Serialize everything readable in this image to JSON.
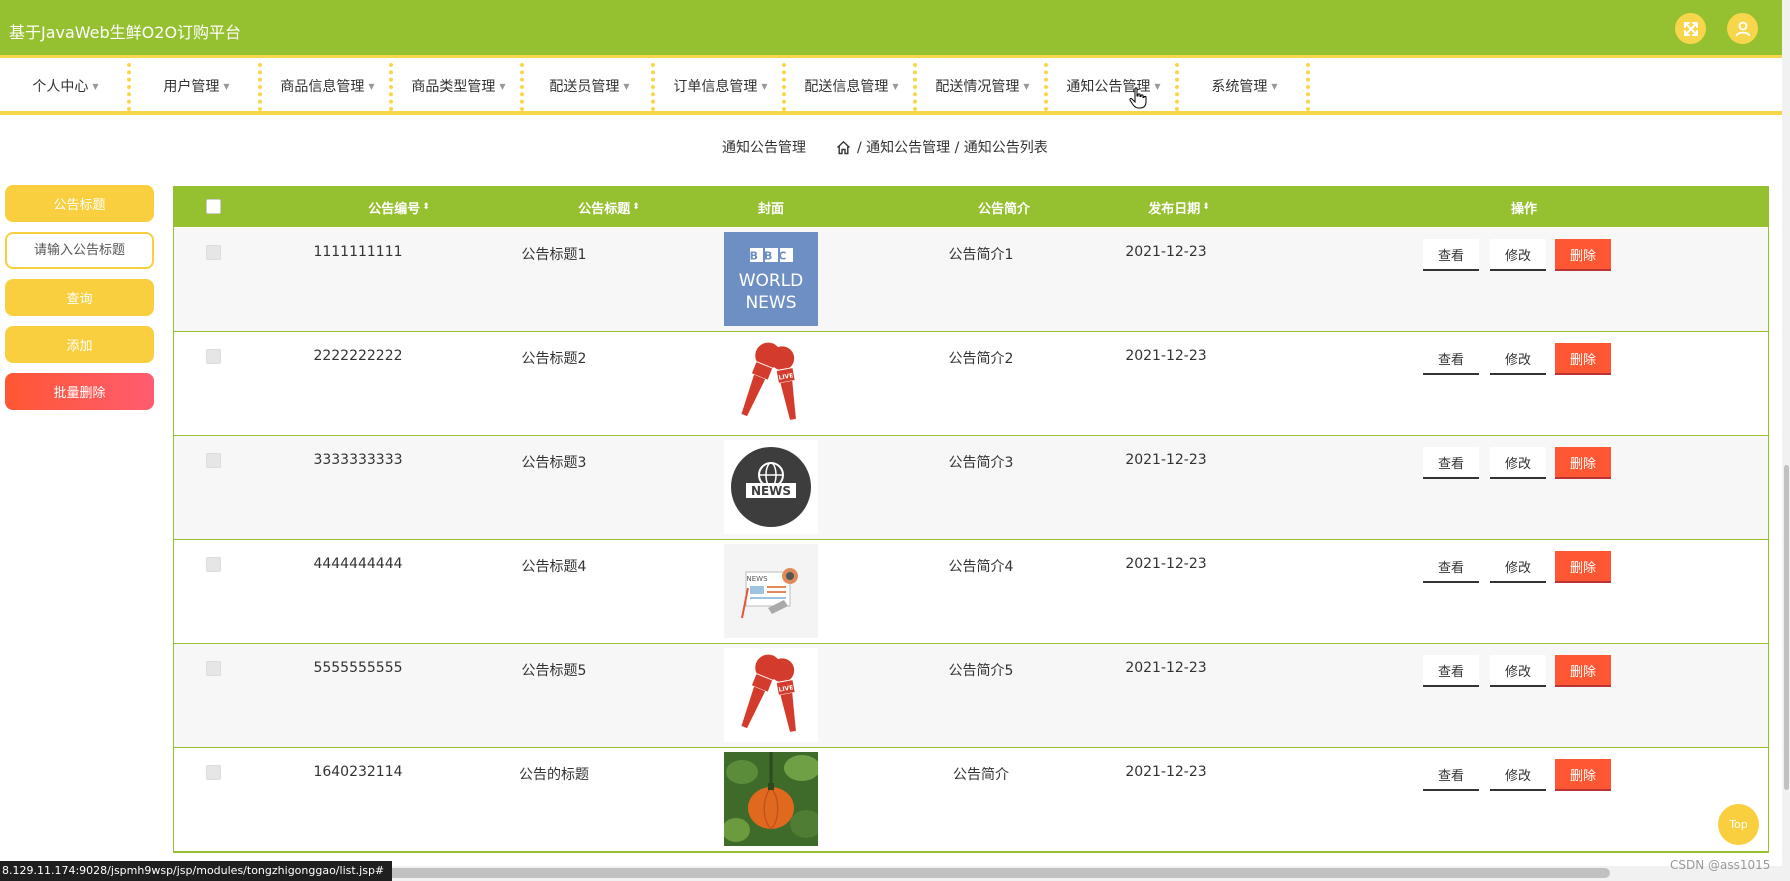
{
  "app": {
    "title": "基于JavaWeb生鲜O2O订购平台"
  },
  "nav": [
    {
      "label": "个人中心"
    },
    {
      "label": "用户管理"
    },
    {
      "label": "商品信息管理"
    },
    {
      "label": "商品类型管理"
    },
    {
      "label": "配送员管理"
    },
    {
      "label": "订单信息管理"
    },
    {
      "label": "配送信息管理"
    },
    {
      "label": "配送情况管理"
    },
    {
      "label": "通知公告管理"
    },
    {
      "label": "系统管理"
    }
  ],
  "breadcrumb": {
    "title": "通知公告管理",
    "trail": "/ 通知公告管理 / 通知公告列表"
  },
  "sidebar": {
    "search_label": "公告标题",
    "search_placeholder": "请输入公告标题",
    "query_label": "查询",
    "add_label": "添加",
    "batch_delete_label": "批量删除"
  },
  "table": {
    "headers": {
      "id": "公告编号",
      "title": "公告标题",
      "cover": "封面",
      "intro": "公告简介",
      "date": "发布日期",
      "actions": "操作"
    },
    "sort_glyph": "⬍",
    "rows": [
      {
        "id": "1111111111",
        "title": "公告标题1",
        "intro": "公告简介1",
        "date": "2021-12-23",
        "cover": "bbc-world-news-image"
      },
      {
        "id": "2222222222",
        "title": "公告标题2",
        "intro": "公告简介2",
        "date": "2021-12-23",
        "cover": "news-microphones-image"
      },
      {
        "id": "3333333333",
        "title": "公告标题3",
        "intro": "公告简介3",
        "date": "2021-12-23",
        "cover": "news-globe-image"
      },
      {
        "id": "4444444444",
        "title": "公告标题4",
        "intro": "公告简介4",
        "date": "2021-12-23",
        "cover": "news-paper-image"
      },
      {
        "id": "5555555555",
        "title": "公告标题5",
        "intro": "公告简介5",
        "date": "2021-12-23",
        "cover": "news-microphones-image"
      },
      {
        "id": "1640232114",
        "title": "公告的标题",
        "intro": "公告简介",
        "date": "2021-12-23",
        "cover": "pumpkin-plant-image"
      }
    ],
    "actions": {
      "view": "查看",
      "edit": "修改",
      "delete": "删除"
    }
  },
  "cover_text": {
    "bbc": "BBC",
    "world": "WORLD",
    "news_upper": "NEWS",
    "live": "LIVE"
  },
  "status_url": "8.129.11.174:9028/jspmh9wsp/jsp/modules/tongzhigonggao/list.jsp#",
  "top_button": "Top",
  "watermark": "CSDN @ass1015",
  "colors": {
    "header": "#95c02f",
    "accent_yellow": "#f8d64b",
    "button_yellow": "#f9cf3f",
    "delete_red": "#ff5733"
  },
  "icons": {
    "fullscreen": "fullscreen-icon",
    "user": "user-icon",
    "home": "home-icon",
    "cursor": "hand-cursor-icon"
  }
}
